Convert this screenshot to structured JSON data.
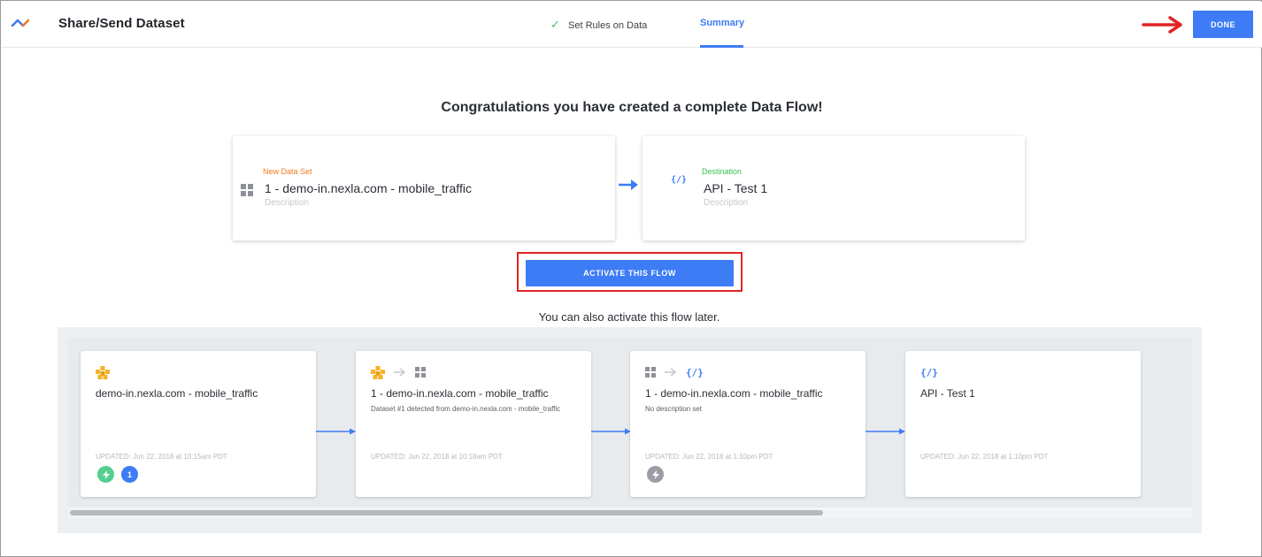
{
  "header": {
    "title": "Share/Send Dataset",
    "steps": [
      {
        "label": "Set Rules on Data",
        "status": "complete"
      },
      {
        "label": "Summary",
        "status": "active"
      }
    ],
    "done_label": "DONE"
  },
  "summary": {
    "congrats": "Congratulations you have created a complete Data Flow!",
    "source": {
      "kicker": "New Data Set",
      "name": "1 - demo-in.nexla.com - mobile_traffic",
      "description_placeholder": "Description"
    },
    "destination": {
      "kicker": "Destination",
      "name": "API - Test 1",
      "description_placeholder": "Description",
      "icon": "{/}"
    },
    "activate_label": "ACTIVATE THIS FLOW",
    "later_note": "You can also activate this flow later."
  },
  "pipeline": {
    "cards": [
      {
        "name": "demo-in.nexla.com - mobile_traffic",
        "detail": "",
        "updated": "UPDATED: Jun 22, 2018 at 10:15am PDT",
        "badges": [
          {
            "kind": "bolt",
            "color": "#55cf8f"
          },
          {
            "kind": "count",
            "value": "1",
            "color": "#3d7cf5"
          }
        ]
      },
      {
        "name": "1 - demo-in.nexla.com - mobile_traffic",
        "detail": "Dataset #1 detected from demo-in.nexla.com - mobile_traffic",
        "updated": "UPDATED: Jun 22, 2018 at 10:18am PDT"
      },
      {
        "name": "1 - demo-in.nexla.com - mobile_traffic",
        "detail": "No description set",
        "updated": "UPDATED: Jun 22, 2018 at 1:10pm PDT",
        "badges": [
          {
            "kind": "bolt",
            "color": "#9a9ea4"
          }
        ]
      },
      {
        "name": "API - Test 1",
        "detail": "",
        "updated": "UPDATED: Jun 22, 2018 at 1:10pm PDT",
        "icon": "{/}"
      }
    ]
  },
  "colors": {
    "accent": "#3d7cf5",
    "new_dataset": "#f07b1e",
    "destination": "#33c24d",
    "annotation_red": "#e02424"
  }
}
